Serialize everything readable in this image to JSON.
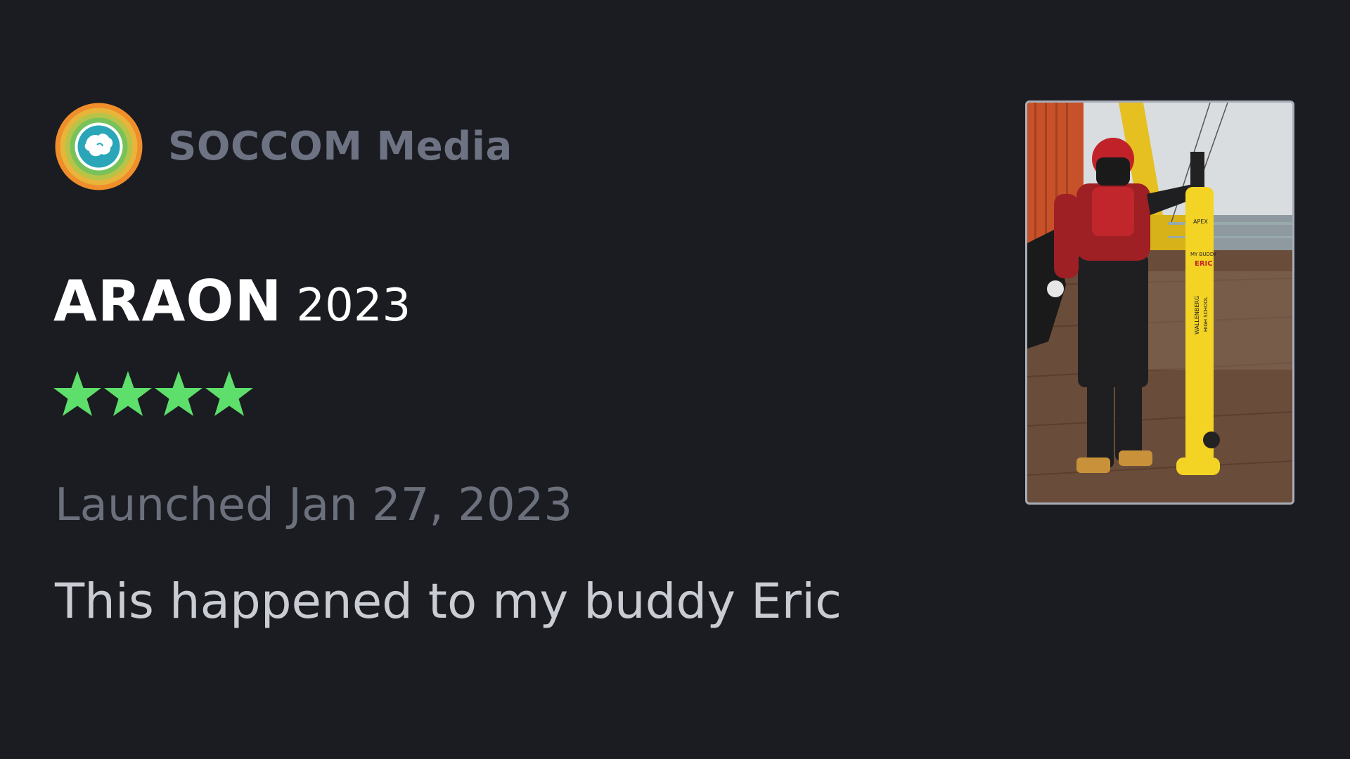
{
  "publisher": {
    "name": "SOCCOM Media",
    "logo_icon": "antarctica-globe-icon"
  },
  "float": {
    "name": "ARAON",
    "year": "2023",
    "rating": 4,
    "rating_max": 4,
    "star_color": "#5ede6b",
    "launched": "Launched Jan 27, 2023",
    "caption": "This happened to my buddy Eric"
  },
  "photo": {
    "subject": "float-deployment-photo",
    "float_text": {
      "brand": "APEX",
      "line1": "MY BUDDY",
      "line2": "ERIC",
      "line3": "WALLENBERG",
      "line4": "HIGH SCHOOL"
    }
  },
  "colors": {
    "background": "#1a1c21",
    "publisher_text": "#6d7382",
    "title_text": "#ffffff",
    "launched_text": "#6b707c",
    "caption_text": "#c9ccd3"
  }
}
